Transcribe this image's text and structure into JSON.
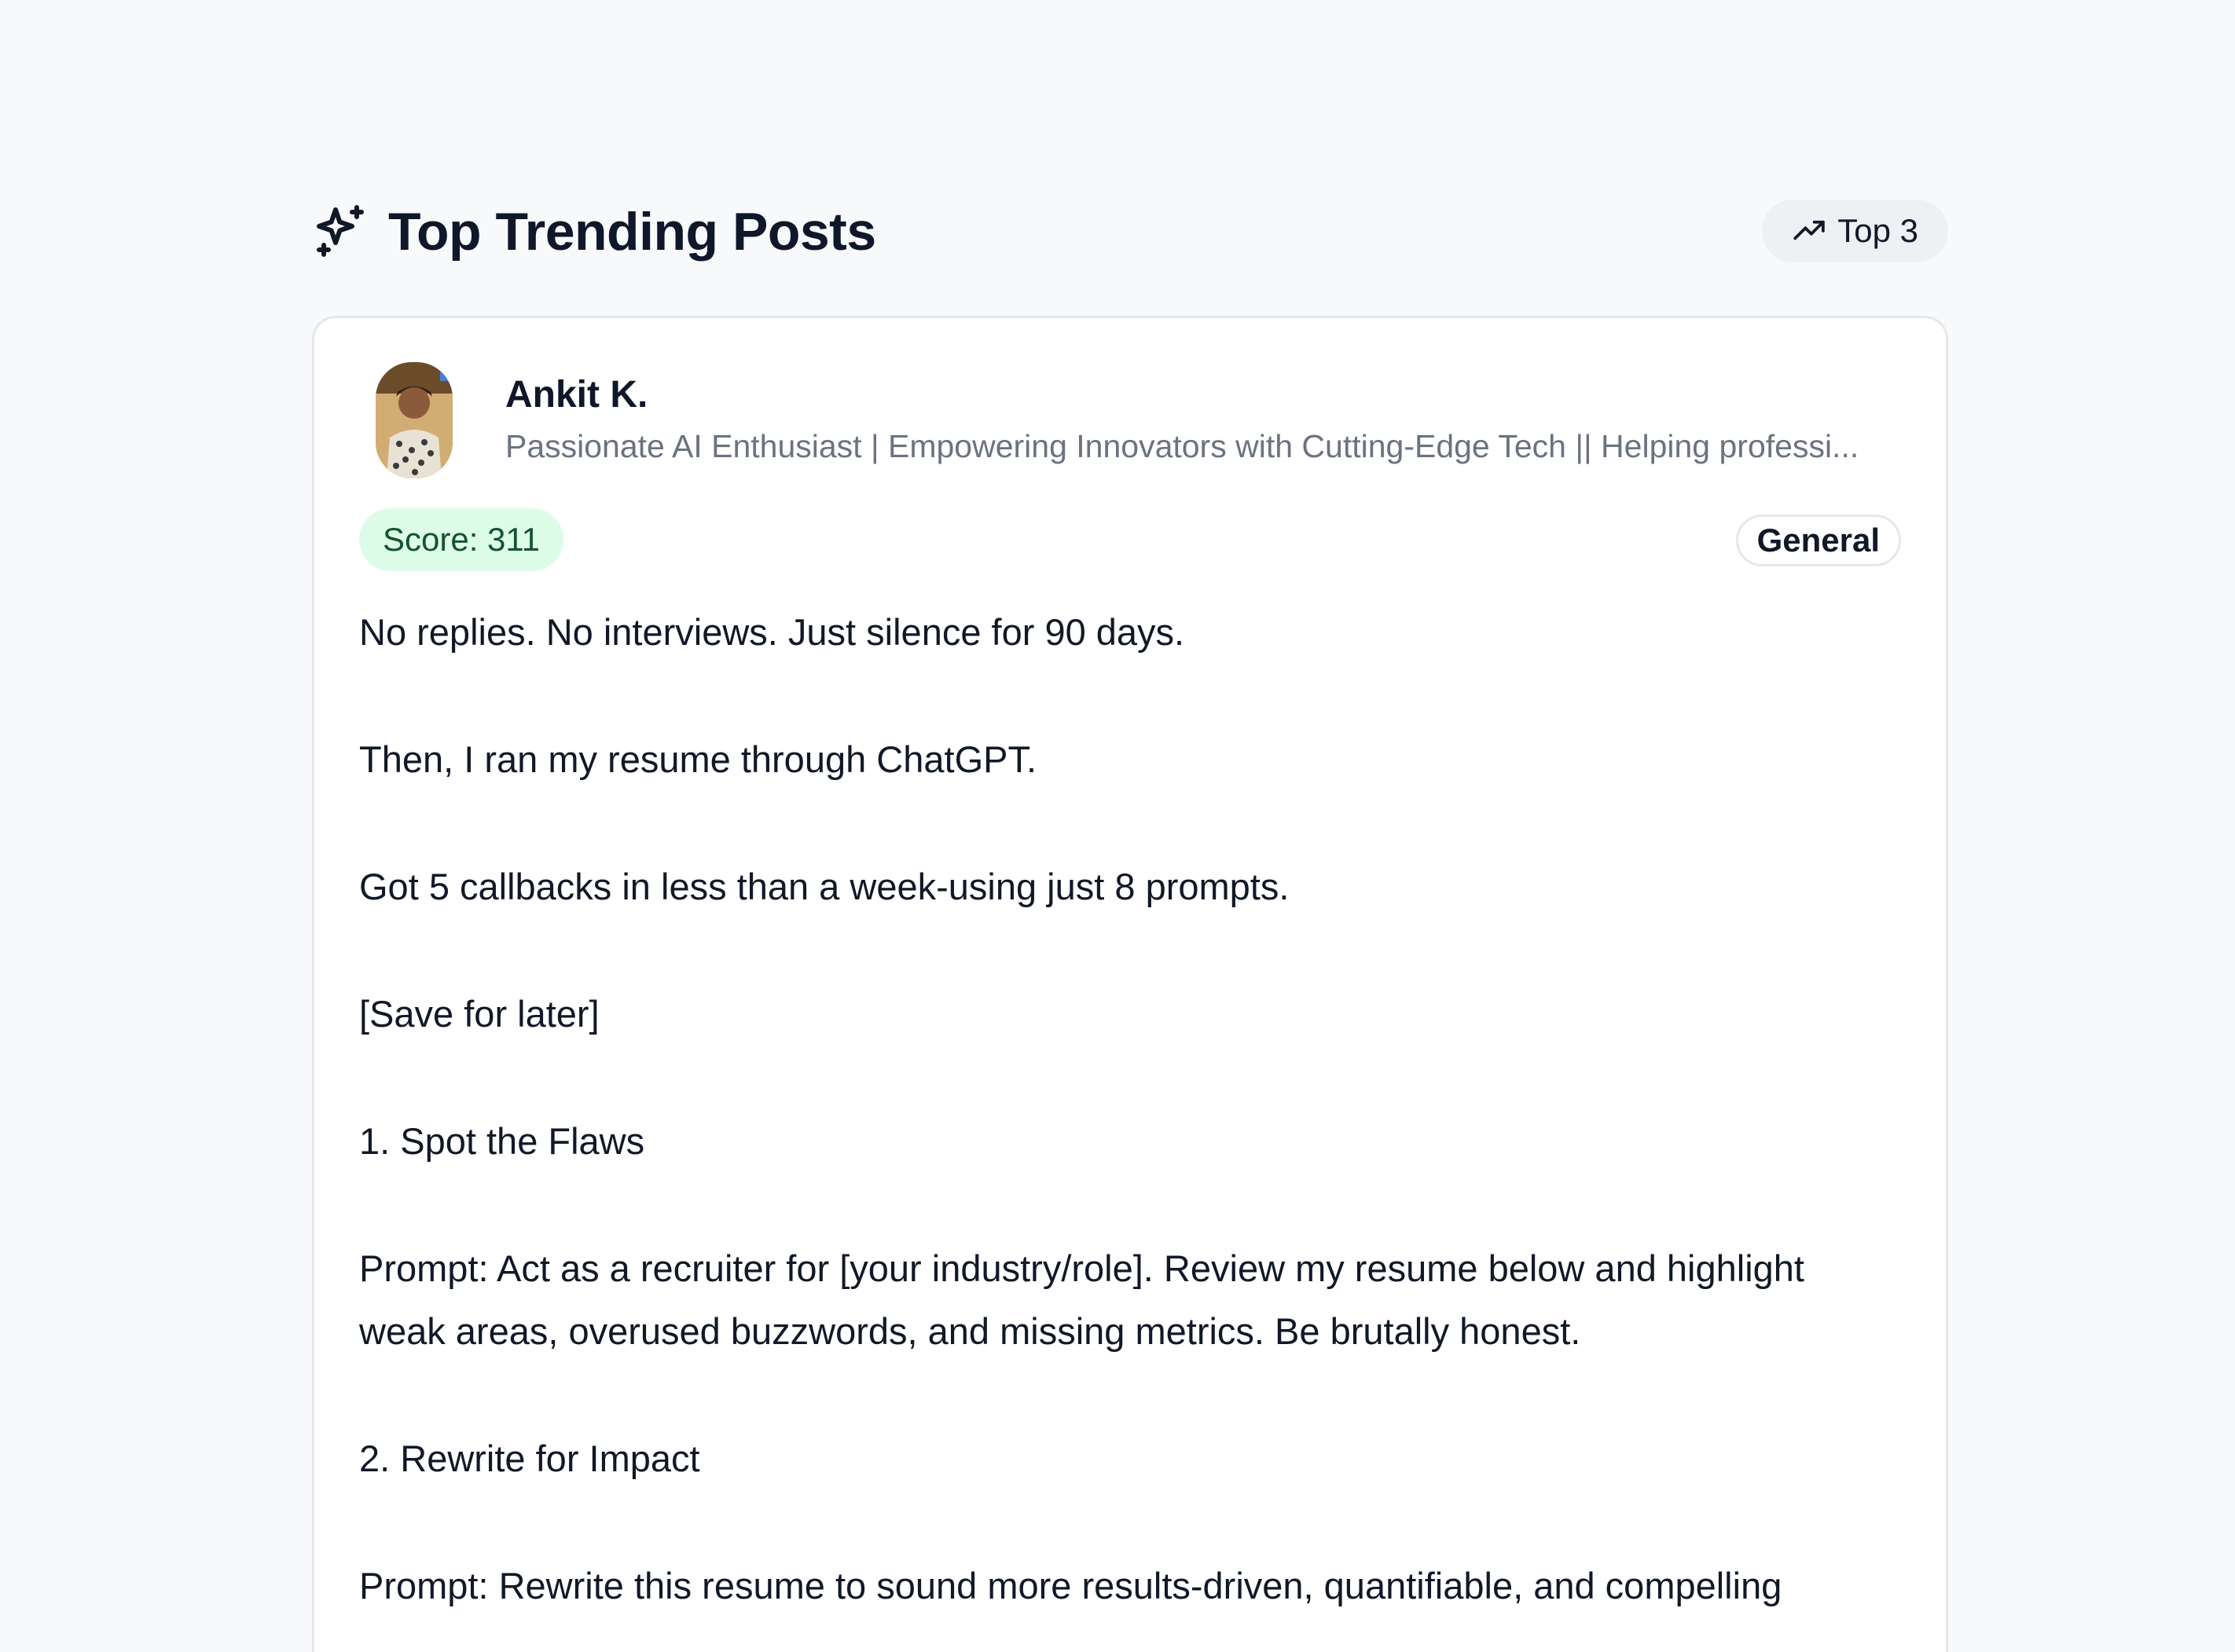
{
  "header": {
    "title": "Top Trending Posts",
    "badge_label": "Top 3",
    "icon": "sparkles-icon",
    "badge_icon": "trending-up-icon"
  },
  "post": {
    "author_name": "Ankit K.",
    "author_headline": "Passionate AI Enthusiast | Empowering Innovators with Cutting-Edge Tech || Helping professi...",
    "score_label": "Score: 311",
    "category": "General",
    "paragraphs": [
      "No replies. No interviews. Just silence for 90 days.",
      "Then, I ran my resume through ChatGPT.",
      "Got 5 callbacks in less than a week-using just 8 prompts.",
      "[Save for later]",
      "1. Spot the Flaws",
      "Prompt: Act as a recruiter for [your industry/role]. Review my resume below and highlight weak areas, overused buzzwords, and missing metrics. Be brutally honest.",
      "2. Rewrite for Impact",
      "Prompt: Rewrite this resume to sound more results-driven, quantifiable, and compelling"
    ]
  },
  "colors": {
    "page_bg": "#f8f9fb",
    "card_border": "#e5e7eb",
    "score_bg": "#dcfce7",
    "score_text": "#14532d",
    "headline_text": "#6b7280"
  }
}
